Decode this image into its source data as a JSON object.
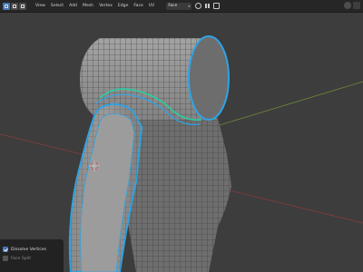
{
  "header": {
    "menus": [
      "View",
      "Select",
      "Add",
      "Mesh",
      "Vertex",
      "Edge",
      "Face",
      "UV"
    ],
    "select_mode": "Face"
  },
  "operator_panel": {
    "options": [
      {
        "label": "Dissolve Vertices",
        "checked": true
      },
      {
        "label": "Face Split",
        "checked": false
      }
    ]
  },
  "colors": {
    "accent": "#4772b3",
    "selection_outline": "#2fa4e6",
    "active_edge": "#27d0a2",
    "background": "#3d3d3d"
  },
  "icons": [
    "editor-type-icon",
    "vertex-mode-icon",
    "edge-mode-icon",
    "face-mode-icon",
    "transform-pivot-icon",
    "snap-icon",
    "proportional-edit-icon",
    "viewport-overlay-icon",
    "shading-icon"
  ]
}
